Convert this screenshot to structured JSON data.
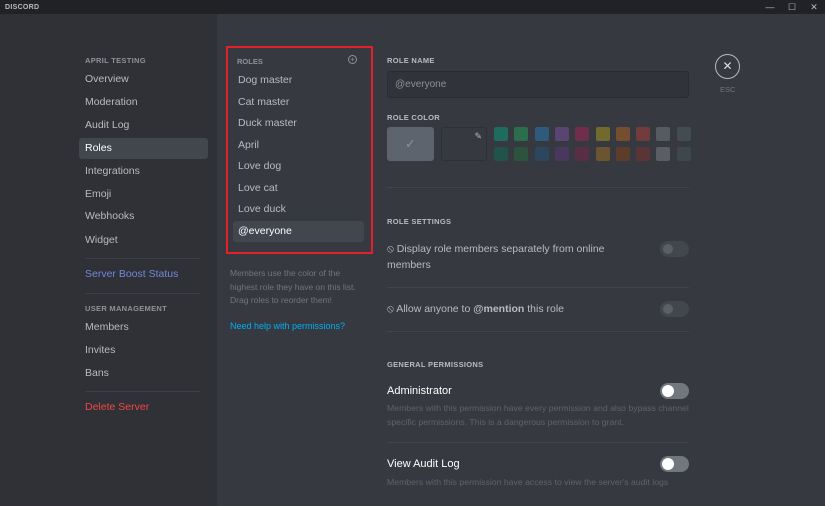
{
  "titlebar": {
    "logo": "DISCORD",
    "minimize": "—",
    "maximize": "☐",
    "close": "✕"
  },
  "sidebar": {
    "server_header": "APRIL TESTING",
    "items": [
      "Overview",
      "Moderation",
      "Audit Log",
      "Roles",
      "Integrations",
      "Emoji",
      "Webhooks",
      "Widget"
    ],
    "boost": "Server Boost Status",
    "user_mgmt_header": "USER MANAGEMENT",
    "user_items": [
      "Members",
      "Invites",
      "Bans"
    ],
    "delete": "Delete Server"
  },
  "roles": {
    "header": "ROLES",
    "add_icon": "+",
    "items": [
      "Dog master",
      "Cat master",
      "Duck master",
      "April",
      "Love dog",
      "Love cat",
      "Love duck",
      "@everyone"
    ],
    "hint": "Members use the color of the highest role they have on this list. Drag roles to reorder them!",
    "help": "Need help with permissions?"
  },
  "editor": {
    "role_name_label": "ROLE NAME",
    "role_name_value": "@everyone",
    "role_color_label": "ROLE COLOR",
    "check": "✓",
    "picker": "✎",
    "colors_top": [
      "#1f6b5d",
      "#2c6e4b",
      "#2f5a7c",
      "#5a4572",
      "#6f2f4c",
      "#726a2c",
      "#744e2e",
      "#723c3c",
      "#555b60",
      "#434b53"
    ],
    "colors_bottom": [
      "#1f534b",
      "#2b533d",
      "#2d4660",
      "#4a3760",
      "#5a2d47",
      "#6b5530",
      "#5d3c2a",
      "#5b3436",
      "#5a5e63",
      "#3e474d"
    ],
    "role_settings_label": "ROLE SETTINGS",
    "setting1": "Display role members separately from online members",
    "setting2_pre": "Allow anyone to ",
    "setting2_bold": "@mention",
    "setting2_post": " this role",
    "deny_icon": "⃠",
    "general_label": "GENERAL PERMISSIONS",
    "perms": [
      {
        "title": "Administrator",
        "desc": "Members with this permission have every permission and also bypass channel specific permissions. This is a dangerous permission to grant."
      },
      {
        "title": "View Audit Log",
        "desc": "Members with this permission have access to view the server's audit logs"
      }
    ]
  },
  "esc": {
    "icon": "✕",
    "label": "ESC"
  }
}
